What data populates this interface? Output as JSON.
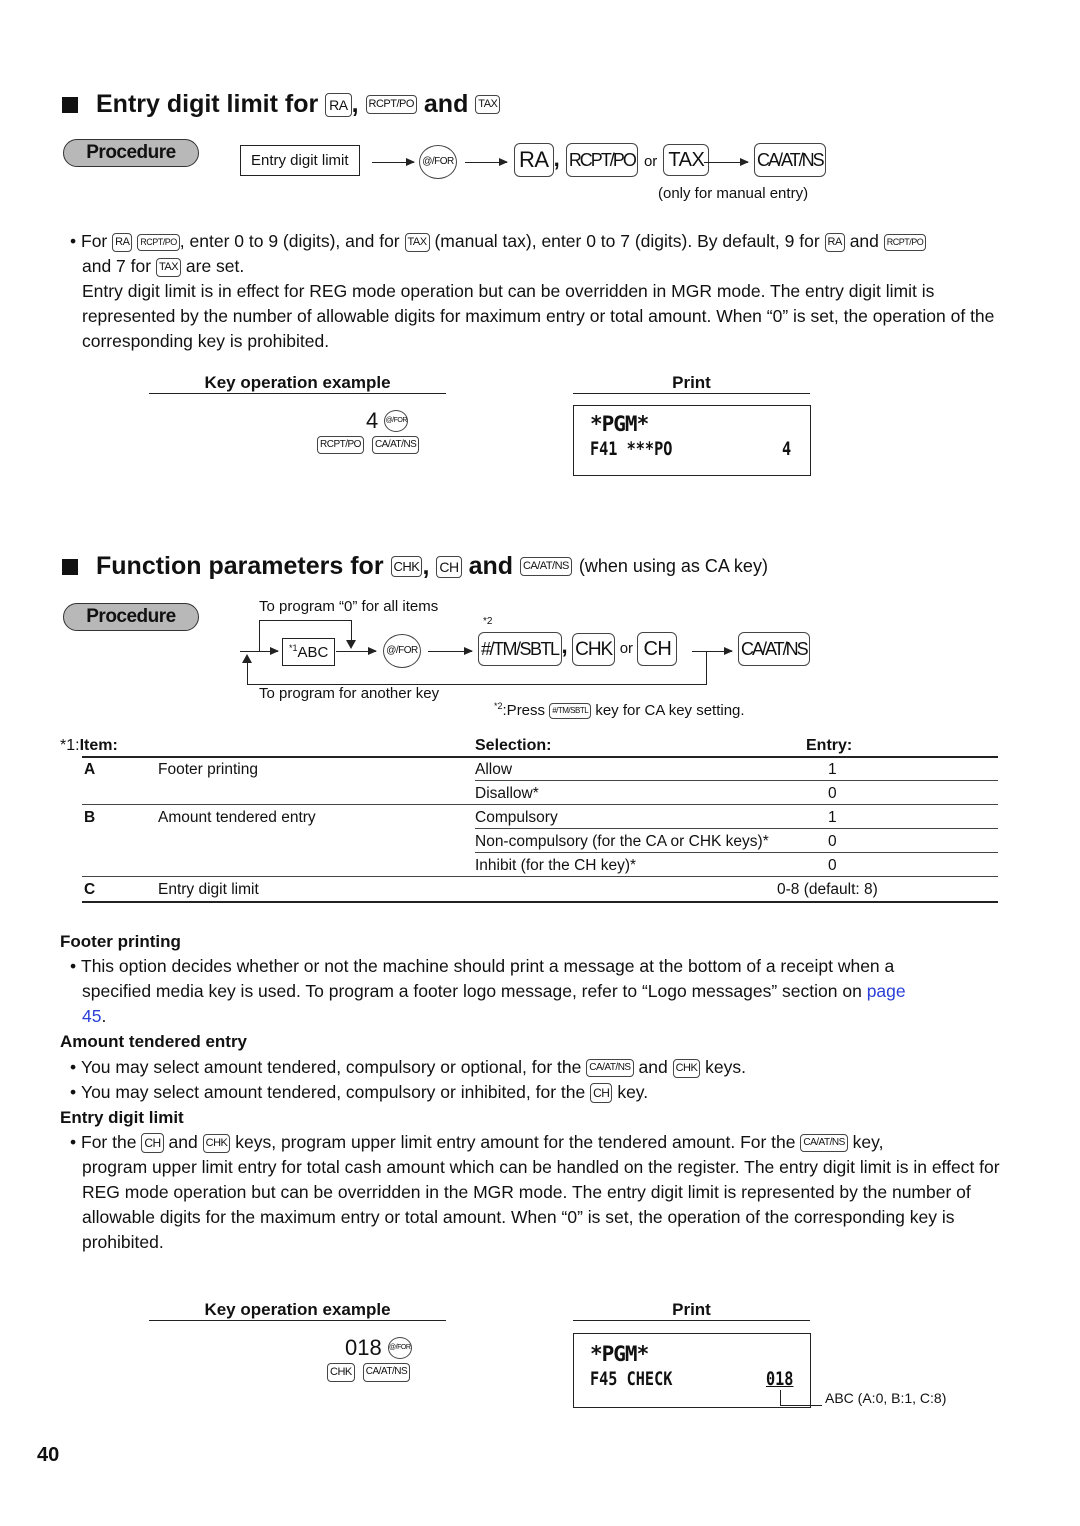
{
  "section1": {
    "title_prefix": "Entry digit limit for",
    "keys": [
      "RA",
      "RCPT/PO",
      "TAX"
    ],
    "comma": ",",
    "and": "and",
    "procedure_label": "Procedure",
    "flow": {
      "input_box": "Entry digit limit",
      "for_key": "@/FOR",
      "key1": "RA",
      "comma": ",",
      "key2": "RCPT/PO",
      "or": "or",
      "key3": "TAX",
      "final_key": "CA/AT/NS",
      "note": "(only for manual entry)"
    },
    "bullet_line1_parts": [
      "For",
      "RA",
      "RCPT/PO",
      ", enter 0 to 9 (digits), and for",
      "TAX",
      "(manual tax), enter 0 to 7 (digits).  By default, 9 for",
      "RA",
      "and",
      "RCPT/PO"
    ],
    "bullet_line2_parts": [
      "and 7 for",
      "TAX",
      "are set."
    ],
    "paragraph": "Entry digit limit is in effect for REG mode operation but can be overridden in MGR mode.  The entry digit limit is represented by the number of allowable digits for maximum entry or total amount.  When “0” is set, the operation of the corresponding key is prohibited.",
    "example": {
      "key_op_header": "Key operation example",
      "print_header": "Print",
      "entry_value": "4",
      "for_key": "@/FOR",
      "keys": [
        "RCPT/PO",
        "CA/AT/NS"
      ],
      "print_line1": "*PGM*",
      "print_line2_code": "F41",
      "print_line2_name": "***PO",
      "print_line2_value": "4"
    }
  },
  "section2": {
    "title_prefix": "Function parameters for",
    "keys": [
      "CHK",
      "CH",
      "CA/AT/NS"
    ],
    "comma": ",",
    "and": "and",
    "suffix": "(when using as CA key)",
    "procedure_label": "Procedure",
    "flow": {
      "top_note": "To program  “0” for all items",
      "footnote_mark": "*2",
      "input_box_sup": "*1",
      "input_box": "ABC",
      "for_key": "@/FOR",
      "key1": "#/TM/SBTL",
      "comma": ",",
      "key2": "CHK",
      "or": "or",
      "key3": "CH",
      "final_key": "CA/AT/NS",
      "bottom_note": "To program for another key",
      "footnote_prefix": "*2",
      "footnote_press": ":Press",
      "footnote_key": "#/TM/SBTL",
      "footnote_suffix": "key for CA key setting."
    },
    "table": {
      "item_header_prefix": "*1:",
      "item_header": "Item:",
      "selection_header": "Selection:",
      "entry_header": "Entry:",
      "rows": [
        {
          "code": "A",
          "item": "Footer printing",
          "selection": "Allow",
          "entry": "1"
        },
        {
          "code": "",
          "item": "",
          "selection": "Disallow*",
          "entry": "0"
        },
        {
          "code": "B",
          "item": "Amount tendered entry",
          "selection": "Compulsory",
          "entry": "1"
        },
        {
          "code": "",
          "item": "",
          "selection": "Non-compulsory (for the CA or CHK keys)*",
          "entry": "0"
        },
        {
          "code": "",
          "item": "",
          "selection": "Inhibit (for the CH key)*",
          "entry": "0"
        },
        {
          "code": "C",
          "item": "Entry digit limit",
          "selection": "",
          "entry": "0-8 (default: 8)"
        }
      ]
    },
    "footer_printing": {
      "heading": "Footer printing",
      "text_line1": "This option decides whether or not the machine should print a message at the bottom of a receipt when a",
      "text_line2": "specified media key is used.  To program a footer logo message, refer to “Logo messages” section on",
      "link_page": "page",
      "link_num": "45",
      "period": "."
    },
    "amount_tendered": {
      "heading": "Amount tendered entry",
      "b1_pre": "You may select amount tendered, compulsory or optional, for the",
      "b1_key1": "CA/AT/NS",
      "b1_and": "and",
      "b1_key2": "CHK",
      "b1_post": "keys.",
      "b2_pre": "You may select amount tendered, compulsory or inhibited, for the",
      "b2_key": "CH",
      "b2_post": "key."
    },
    "entry_digit_limit": {
      "heading": "Entry digit limit",
      "l1_pre": "For the",
      "l1_key1": "CH",
      "l1_and": "and",
      "l1_key2": "CHK",
      "l1_mid": "keys, program upper limit entry amount for the tendered amount.  For the",
      "l1_key3": "CA/AT/NS",
      "l1_post": "key,",
      "rest": "program upper limit entry for total cash amount which can be handled on the register.  The entry digit limit is in effect for REG mode operation but can be overridden in the MGR mode.  The entry digit limit is represented by the number of allowable digits for the maximum entry or total amount.  When “0” is set, the operation of the corresponding key is prohibited."
    },
    "example": {
      "key_op_header": "Key operation example",
      "print_header": "Print",
      "entry_value": "018",
      "for_key": "@/FOR",
      "keys": [
        "CHK",
        "CA/AT/NS"
      ],
      "print_line1": "*PGM*",
      "print_line2_code": "F45",
      "print_line2_name": "CHECK",
      "print_line2_value": "018",
      "callout": "ABC (A:0, B:1, C:8)"
    }
  },
  "page_number": "40"
}
